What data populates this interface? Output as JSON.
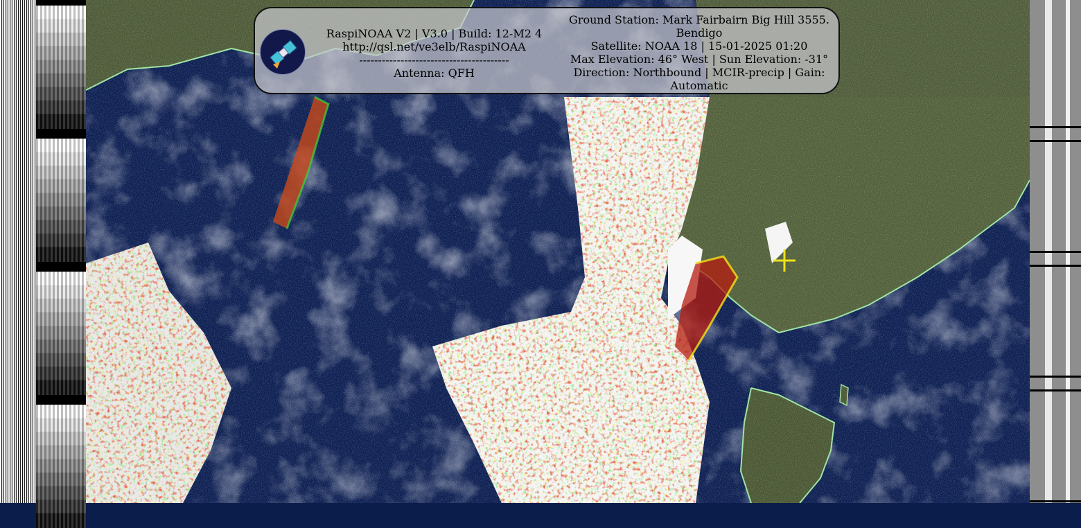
{
  "overlay": {
    "software": "RaspiNOAA V2 | V3.0 | Build: 12-M2 4",
    "url": "http://qsl.net/ve3elb/RaspiNOAA",
    "separator": "----------------------------------------",
    "antenna": "Antenna: QFH",
    "ground_station": "Ground Station: Mark Fairbairn Big Hill 3555. Bendigo",
    "satellite": "Satellite: NOAA 18 | 15-01-2025 01:20",
    "elevation": "Max Elevation: 46° West | Sun Elevation: -31°",
    "direction": "Direction: Northbound | MCIR-precip | Gain: Automatic",
    "logo_icon": "satellite-icon"
  },
  "image": {
    "colors": {
      "ocean": "#0d1f52",
      "land": "#4f5d35",
      "cloud": "#ffffff",
      "coastline": "#9be3a0",
      "precip_green": "#39d63a",
      "precip_yellow": "#f2e21a",
      "precip_red": "#c51d0f",
      "marker": "#f2e21a"
    },
    "marker_icon": "ground-station-cross-icon"
  }
}
